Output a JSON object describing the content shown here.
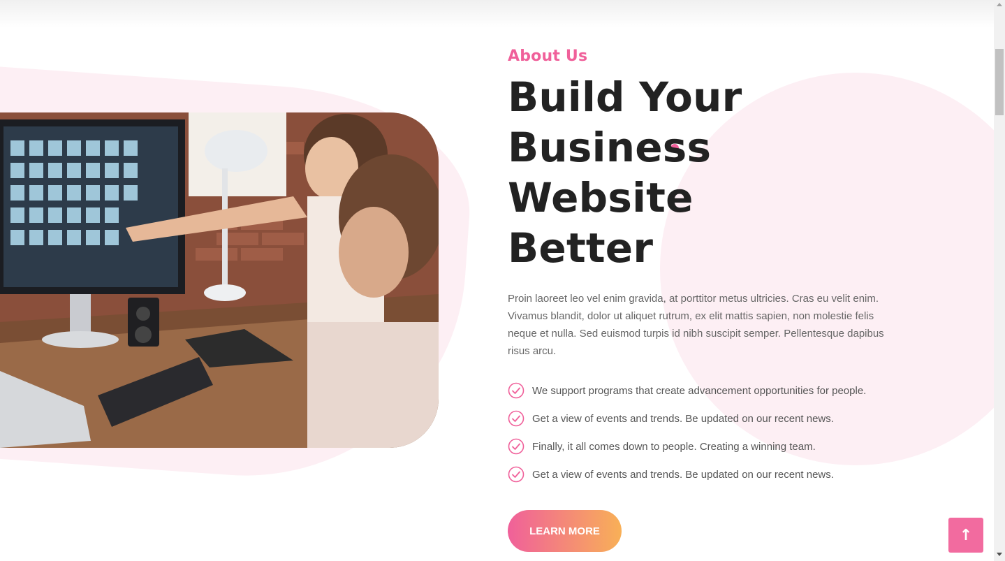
{
  "about": {
    "eyebrow": "About Us",
    "headline_line1": "Build Your",
    "headline_line2": "Business Website",
    "headline_line3": "Better",
    "intro": "Proin laoreet leo vel enim gravida, at porttitor metus ultricies. Cras eu velit enim. Vivamus blandit, dolor ut aliquet rutrum, ex elit mattis sapien, non molestie felis neque et nulla. Sed euismod turpis id nibh suscipit semper. Pellentesque dapibus risus arcu.",
    "checklist": [
      "We support programs that create advancement opportunities for people.",
      "Get a view of events and trends. Be updated on our recent news.",
      "Finally, it all comes down to people. Creating a winning team.",
      "Get a view of events and trends. Be updated on our recent news."
    ],
    "cta_label": "LEARN MORE"
  },
  "back_to_top": {
    "icon": "arrow-up-icon",
    "glyph": "↑"
  },
  "colors": {
    "accent_pink": "#f0609a",
    "accent_orange": "#f8b057",
    "blob_pink": "#fdeff4",
    "heading": "#222222",
    "body_text": "#666666"
  },
  "image": {
    "subject": "team-at-computer-photo"
  }
}
